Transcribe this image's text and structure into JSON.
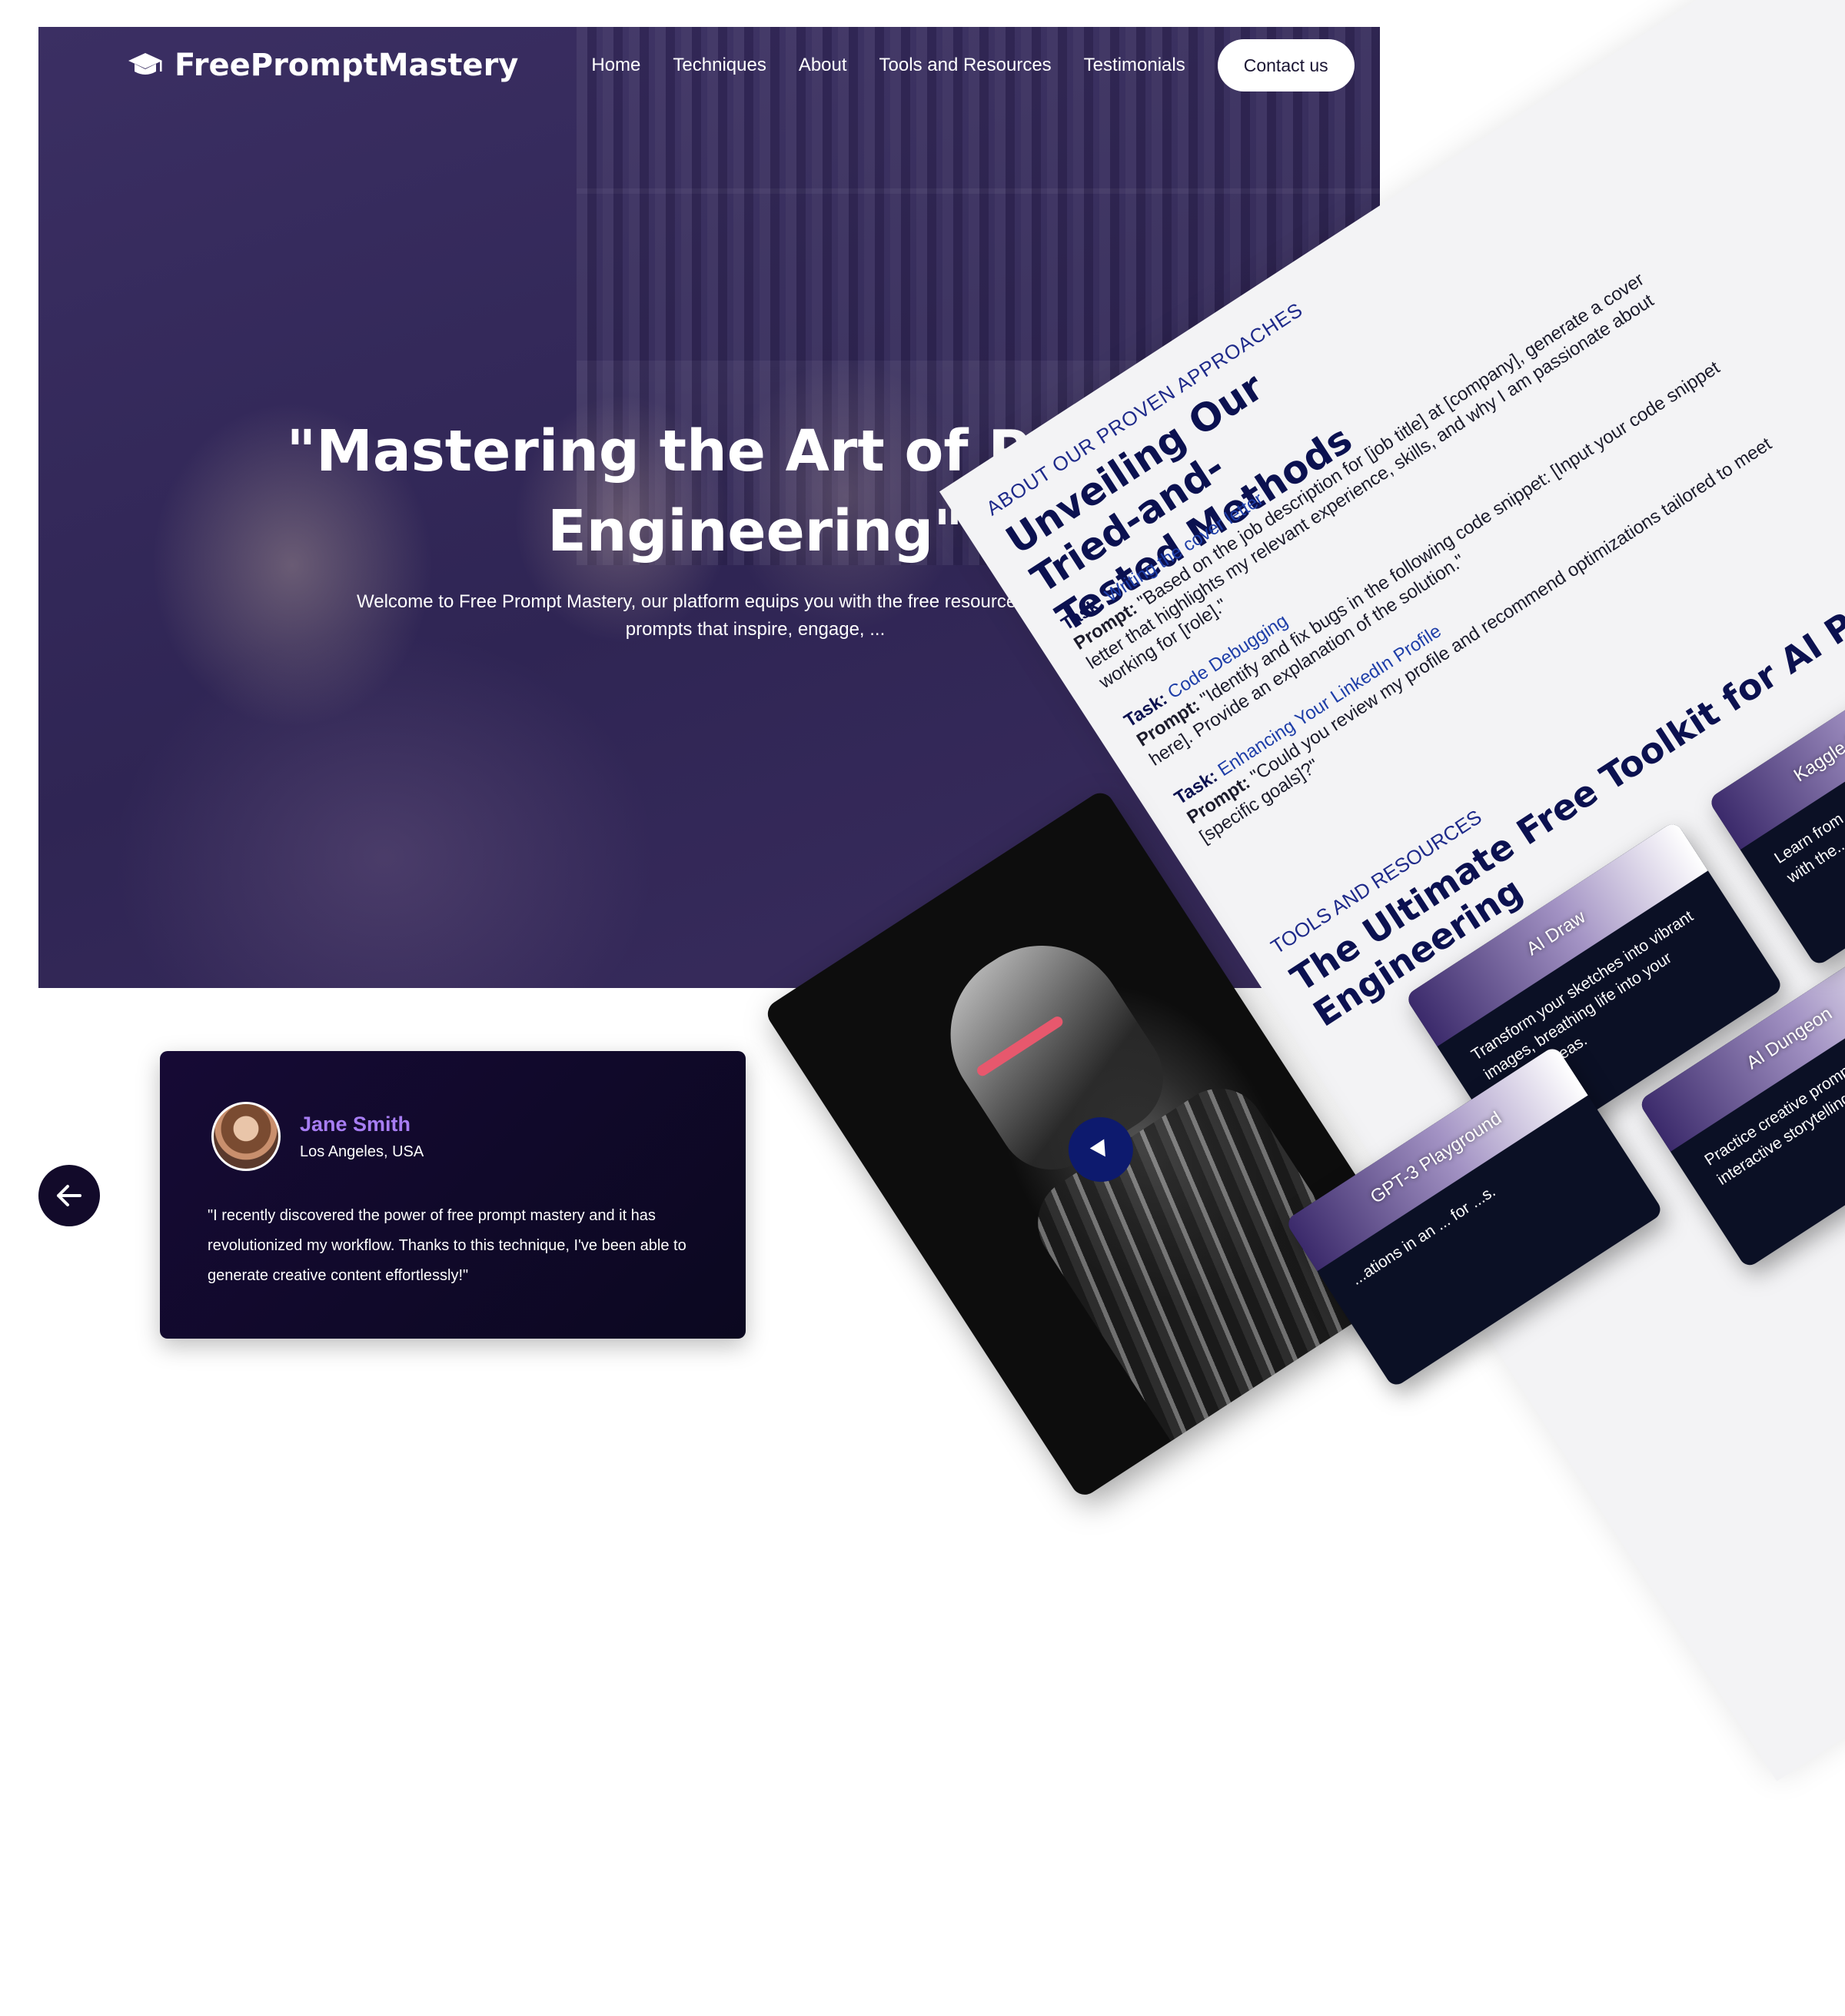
{
  "brand": {
    "name": "FreePromptMastery",
    "icon": "graduation-cap-icon"
  },
  "nav": {
    "links": [
      "Home",
      "Techniques",
      "About",
      "Tools and Resources",
      "Testimonials"
    ],
    "contact": "Contact us"
  },
  "hero": {
    "title": "\"Mastering the Art of Prompt Engineering\"",
    "subtitle": "Welcome to Free Prompt Mastery, our platform equips you with the free resources needed to craft prompts that inspire, engage, ..."
  },
  "testimonial": {
    "name": "Jane Smith",
    "location": "Los Angeles, USA",
    "quote": "\"I recently discovered the power of free prompt mastery and it has revolutionized my workflow. Thanks to this technique, I've been able to generate creative content effortlessly!\"",
    "prev_icon": "arrow-left-icon"
  },
  "about": {
    "eyebrow": "About our proven approaches",
    "title": "Unveiling Our Tried-and-Tested Methods",
    "task_label": "Task:",
    "prompt_label": "Prompt:",
    "methods": [
      {
        "task": "Writing the cover letter",
        "prompt": "\"Based on the job description for [job title] at [company], generate a cover letter that highlights my relevant experience, skills, and why I am passionate about working for [role].\""
      },
      {
        "task": "Code Debugging",
        "prompt": "\"Identify and fix bugs in the following code snippet: [Input your code snippet here]. Provide an explanation of the solution.\""
      },
      {
        "task": "Enhancing Your LinkedIn Profile",
        "prompt": "\"Could you review my profile and recommend optimizations tailored to meet [specific goals]?\""
      }
    ]
  },
  "video": {
    "play_icon": "play-icon"
  },
  "tools": {
    "eyebrow": "Tools and Resources",
    "title": "The Ultimate Free Toolkit for AI Prompt Engineering",
    "cards": [
      {
        "name": "AI Draw",
        "desc": "Transform your sketches into vibrant images, breathing life into your creative ideas."
      },
      {
        "name": "AI Dungeon",
        "desc": "Practice creative prompt crafting in an interactive storytelling game."
      },
      {
        "name": "Kaggle Notebooks",
        "desc": "Learn from and share p... experiments with the... community."
      },
      {
        "name": "GPT-3 Playground",
        "desc": "...ations in an ... for ...s."
      }
    ]
  },
  "colors": {
    "hero_overlay": "#2f2554",
    "accent_purple": "#a77df3",
    "heading_navy": "#0b1150",
    "card_dark": "#0b1025"
  }
}
